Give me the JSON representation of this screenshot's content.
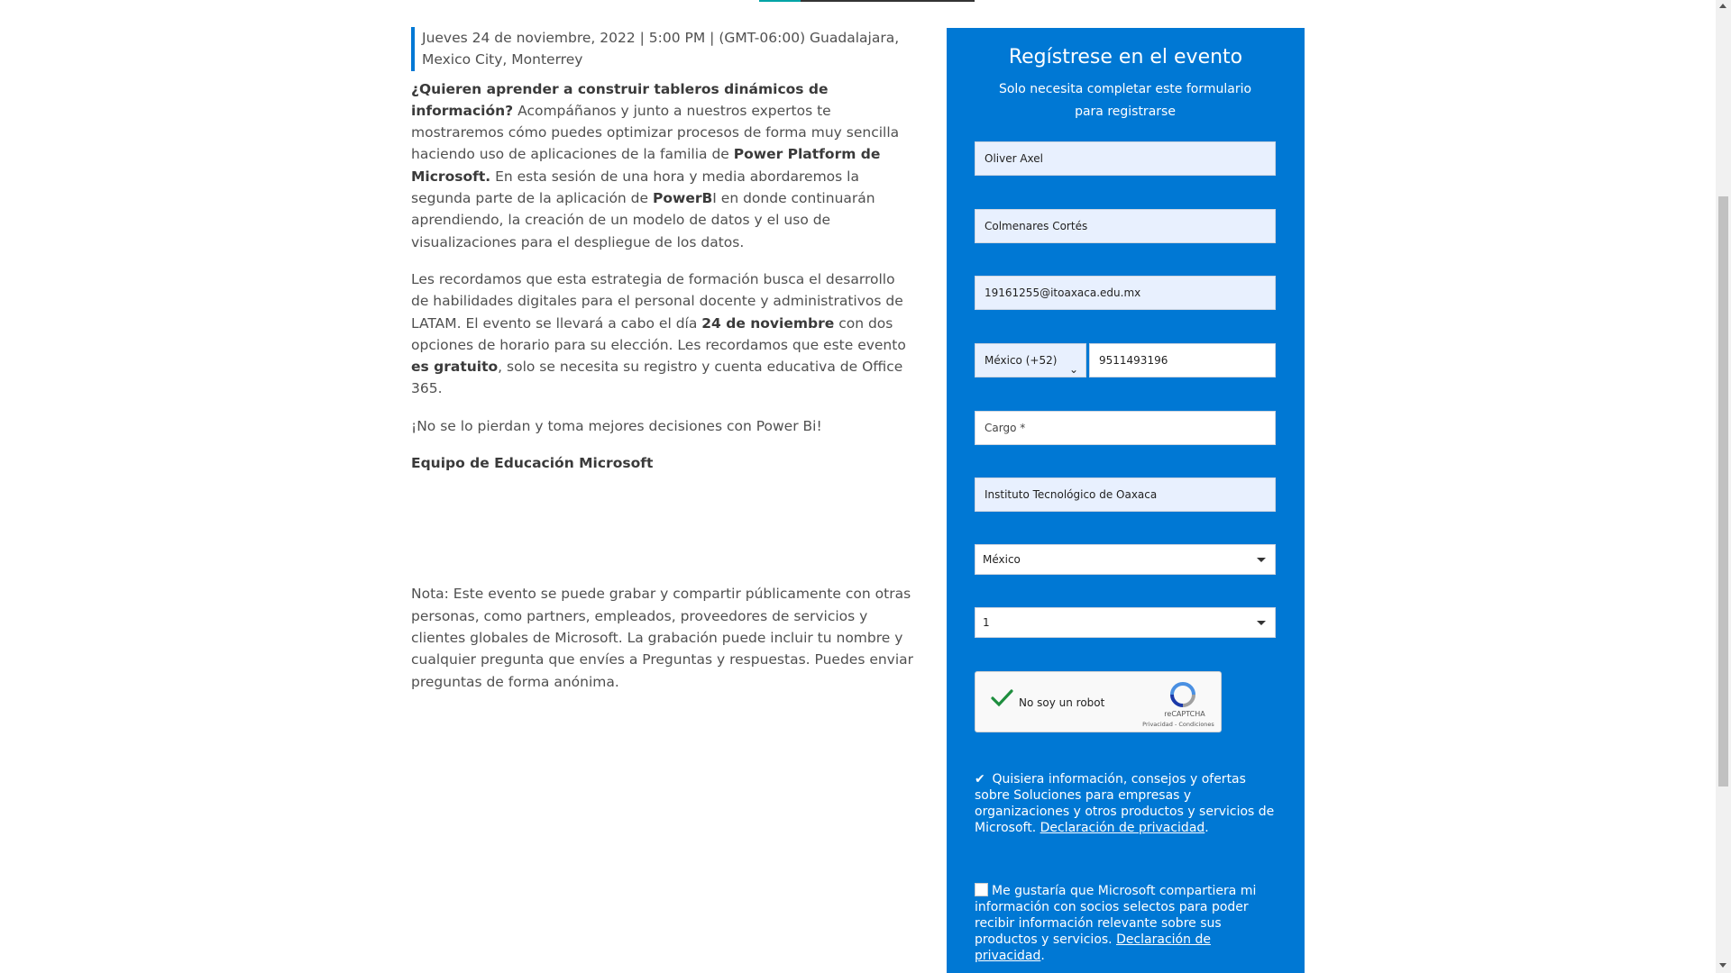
{
  "article": {
    "date": "Jueves 24 de noviembre, 2022 | 5:00 PM | (GMT-06:00) Guadalajara, Mexico City, Monterrey",
    "heading": "¿Quieren aprender a construir tableros dinámicos de información?",
    "p1_a": "Acompáñanos y junto a nuestros expertos te mostraremos cómo puedes optimizar procesos de forma muy sencilla haciendo uso de aplicaciones de la familia de ",
    "p1_b": "Power Platform de Microsoft.",
    "p1_c": " En esta sesión de una hora y media abordaremos la segunda parte de la aplicación de ",
    "p1_d": "PowerB",
    "p1_e": "I en donde continuarán aprendiendo, la creación de un modelo de datos y el uso de visualizaciones para el despliegue de los datos.",
    "p2_a": "Les recordamos que esta estrategia de formación busca el desarrollo de habilidades digitales para el personal docente y administrativos de LATAM. El evento se llevará a cabo el día ",
    "p2_b": "24 de noviembre",
    "p2_c": " con dos opciones de horario para su elección. Les recordamos que este evento ",
    "p2_d": "es gratuito",
    "p2_e": ", solo se necesita su registro y cuenta educativa de Office 365.",
    "p3": "¡No se lo pierdan y toma mejores decisiones con Power Bi!",
    "signature": "Equipo de Educación Microsoft",
    "note": "Nota: Este evento se puede grabar y compartir públicamente con otras personas, como partners, empleados, proveedores de servicios y clientes globales de Microsoft. La grabación puede incluir tu nombre y cualquier pregunta que envíes a Preguntas y respuestas. Puedes enviar preguntas de forma anónima."
  },
  "form": {
    "title": "Regístrese en el evento",
    "subtitle": "Solo necesita completar este formulario para registrarse",
    "first_name": "Oliver Axel",
    "last_name": "Colmenares Cortés",
    "email": "19161255@itoaxaca.edu.mx",
    "country_code": "México (+52)",
    "phone": "9511493196",
    "job_title_placeholder": "Cargo *",
    "organization": "Instituto Tecnológico de Oaxaca",
    "country": "México",
    "org_size": "1",
    "captcha_label": "No soy un robot",
    "captcha_brand": "reCAPTCHA",
    "captcha_terms": "Privacidad - Condiciones",
    "consent1_text": "Quisiera información, consejos y ofertas sobre Soluciones para empresas y organizaciones y otros productos y servicios de Microsoft. ",
    "consent1_link": "Declaración de privacidad",
    "consent2_text": "Me gustaría que Microsoft compartiera mi información con socios selectos para poder recibir información relevante sobre sus productos y servicios. ",
    "consent2_link": "Declaración de privacidad",
    "consent1_checked": true,
    "consent2_checked": false
  },
  "colors": {
    "accent": "#0078d4",
    "panel": "#0078d4",
    "tab_accent": "#00a4a6"
  }
}
